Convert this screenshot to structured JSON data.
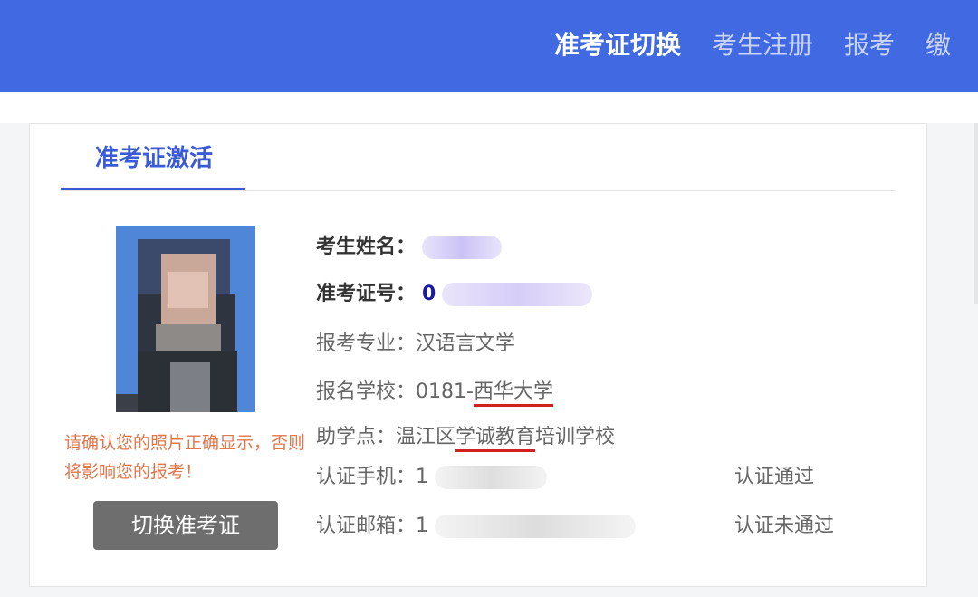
{
  "nav": {
    "items": [
      "准考证切换",
      "考生注册",
      "报考",
      "缴"
    ]
  },
  "tab": {
    "label": "准考证激活"
  },
  "photo": {
    "warning": "请确认您的照片正确显示，否则将影响您的报考！"
  },
  "switch_button": {
    "label": "切换准考证"
  },
  "info": {
    "name_label": "考生姓名：",
    "id_label": "准考证号：",
    "id_value_visible": "0",
    "major_label": "报考专业：",
    "major_value": "汉语言文学",
    "school_label": "报名学校：",
    "school_code": "0181-",
    "school_name": "西华大学",
    "center_label": "助学点：",
    "center_prefix": "温江区",
    "center_underlined": "学诚教育",
    "center_suffix": "培训学校",
    "phone_label": "认证手机：",
    "phone_value_visible": "1",
    "phone_status": "认证通过",
    "email_label": "认证邮箱：",
    "email_value_visible": "1",
    "email_status": "认证未通过"
  },
  "colors": {
    "topbar": "#4169e1",
    "accent": "#3a5bd6",
    "warning": "#e2754a",
    "underline": "#d02020"
  }
}
